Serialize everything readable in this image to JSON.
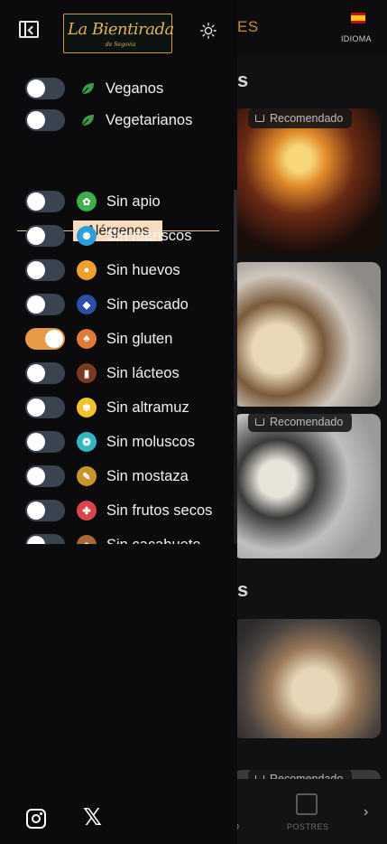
{
  "background": {
    "category_label": "ES",
    "language_label": "IDIOMA",
    "section_title_1": "s",
    "section_title_2": "s",
    "recommended_label": "Recomendado",
    "nav_left_label": "O",
    "nav_postres_label": "POSTRES"
  },
  "drawer": {
    "logo_text": "La Bientirada",
    "logo_sub": "de Segovia",
    "diet_items": [
      {
        "label": "Veganos",
        "on": false
      },
      {
        "label": "Vegetarianos",
        "on": false
      }
    ],
    "allergens_title": "Alérgenos",
    "allergen_items": [
      {
        "label": "Sin apio",
        "on": false,
        "icon": "celery-icon",
        "color": "#3cae4a",
        "glyph": "✿"
      },
      {
        "label": "Sin mariscos",
        "on": false,
        "icon": "crustacean-icon",
        "color": "#2e9fd6",
        "glyph": "✺"
      },
      {
        "label": "Sin huevos",
        "on": false,
        "icon": "egg-icon",
        "color": "#f0a030",
        "glyph": "●"
      },
      {
        "label": "Sin pescado",
        "on": false,
        "icon": "fish-icon",
        "color": "#2c4fa8",
        "glyph": "◆"
      },
      {
        "label": "Sin gluten",
        "on": true,
        "icon": "gluten-icon",
        "color": "#e07a3a",
        "glyph": "♣"
      },
      {
        "label": "Sin lácteos",
        "on": false,
        "icon": "milk-icon",
        "color": "#7a3a22",
        "glyph": "▮"
      },
      {
        "label": "Sin altramuz",
        "on": false,
        "icon": "lupin-icon",
        "color": "#f2c428",
        "glyph": "✽"
      },
      {
        "label": "Sin moluscos",
        "on": false,
        "icon": "mollusc-icon",
        "color": "#33b5c4",
        "glyph": "❂"
      },
      {
        "label": "Sin mostaza",
        "on": false,
        "icon": "mustard-icon",
        "color": "#c7962a",
        "glyph": "✎"
      },
      {
        "label": "Sin frutos secos",
        "on": false,
        "icon": "nuts-icon",
        "color": "#d8454a",
        "glyph": "✤"
      },
      {
        "label": "Sin cacahuete",
        "on": false,
        "icon": "peanut-icon",
        "color": "#a8683a",
        "glyph": "●"
      }
    ]
  },
  "colors": {
    "accent": "#e59a45",
    "toggle_off": "#3a4450",
    "divider": "#f7dcc0"
  }
}
